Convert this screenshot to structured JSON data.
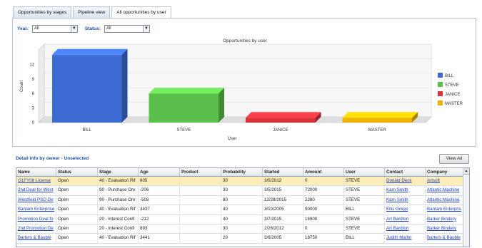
{
  "tabs": [
    {
      "label": "Opportunities by stages",
      "active": false
    },
    {
      "label": "Pipeline view",
      "active": false
    },
    {
      "label": "All opportunities by user",
      "active": true
    }
  ],
  "filters": {
    "year_label": "Year:",
    "year_value": "All",
    "status_label": "Status:",
    "status_value": "All"
  },
  "chart_data": {
    "type": "bar",
    "title": "Opportunities by user",
    "xlabel": "User",
    "ylabel": "Count",
    "categories": [
      "BILL",
      "STEVE",
      "JANICE",
      "MASTER"
    ],
    "values": [
      14,
      6,
      1,
      1
    ],
    "colors": [
      "#3c6bd4",
      "#5bbf4b",
      "#d8323a",
      "#f0b400"
    ],
    "yticks": [
      0,
      3,
      6,
      9,
      12
    ],
    "ylim": [
      0,
      15
    ],
    "legend": [
      "BILL",
      "STEVE",
      "JANICE",
      "MASTER"
    ],
    "legend_position": "right"
  },
  "detail": {
    "header": "Detail info by owner - Unselected",
    "view_all_label": "View All",
    "columns": [
      "Name",
      "Status",
      "Stage",
      "Age",
      "Product",
      "Probability",
      "Started",
      "Amount",
      "User",
      "Contact",
      "Company"
    ],
    "rows": [
      [
        "G1FY08 License",
        "Open",
        "40 - Evaluation Rif",
        "805",
        "",
        "30",
        "3/5/2012",
        "0",
        "STEVE",
        "Donald Deck",
        "Artsoft"
      ],
      [
        "2nd Deal for West",
        "Open",
        "90 - Purchase Ore",
        "-206",
        "",
        "30",
        "3/5/2015",
        "72000",
        "STEVE",
        "Karn Smith",
        "Atlantic Machine"
      ],
      [
        "Westfield PSO De",
        "Open",
        "90 - Purchase Ore",
        "-508",
        "",
        "80",
        "12/28/2015",
        "2280",
        "STEVE",
        "Karn Smith",
        "Atlantic Machine"
      ],
      [
        "Bantam Enterprise",
        "Open",
        "40 - Evaluation Rif",
        "3437",
        "",
        "40",
        "3/10/2005",
        "90000",
        "BILL",
        "Ellis Grego",
        "Bantam Enterpris"
      ],
      [
        "Promotion Deal fo",
        "Open",
        "20 - Interest Confi",
        "-212",
        "",
        "40",
        "3/7/2015",
        "16900",
        "STEVE",
        "Art Bardton",
        "Barker Bindery"
      ],
      [
        "2nd Promotion De",
        "Open",
        "20 - Interest Confi",
        "893",
        "",
        "30",
        "2/26/2012",
        "0",
        "STEVE",
        "Art Bardton",
        "Barker Bindery"
      ],
      [
        "Barters & Bauble",
        "Open",
        "40 - Evaluation Rif",
        "3441",
        "",
        "20",
        "3/6/2005",
        "18750",
        "BILL",
        "Judith Martin",
        "Barters & Bauble"
      ]
    ]
  }
}
